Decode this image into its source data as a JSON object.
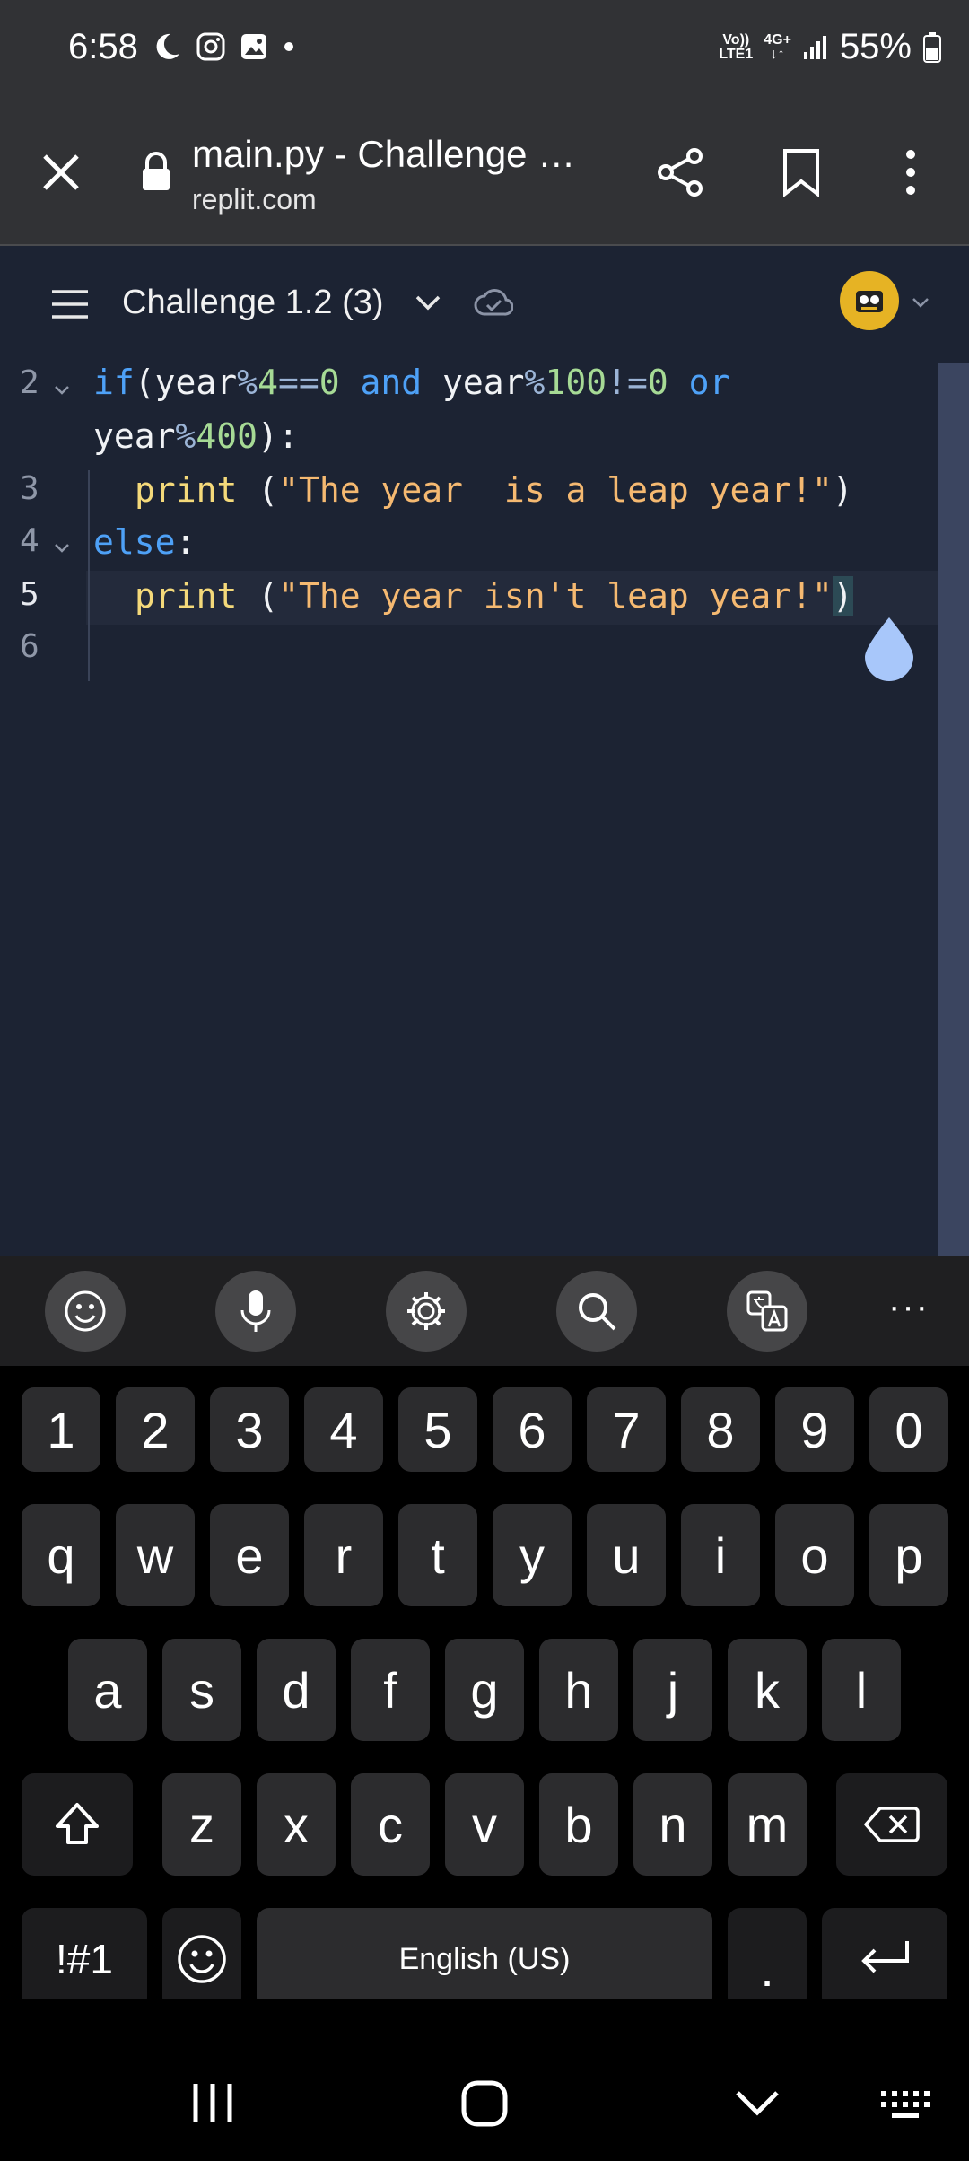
{
  "status": {
    "time": "6:58",
    "net1": "Vo))",
    "net1b": "LTE1",
    "net2": "4G+",
    "battery": "55%"
  },
  "browser": {
    "title": "main.py - Challenge …",
    "url": "replit.com"
  },
  "replit": {
    "project": "Challenge 1.2 (3)"
  },
  "code": {
    "lines": [
      {
        "num": "2"
      },
      {
        "num": "3"
      },
      {
        "num": "4"
      },
      {
        "num": "5"
      },
      {
        "num": "6"
      }
    ],
    "l2a": {
      "kw_if": "if",
      "p1": "(",
      "year1": "year",
      "mod1": "%",
      "n4": "4",
      "eq": "==",
      "n0a": "0",
      "and": "and",
      "year2": "year",
      "mod2": "%",
      "n100": "100",
      "ne": "!=",
      "n0b": "0",
      "or": "or"
    },
    "l2b": {
      "year3": "year",
      "mod3": "%",
      "n400": "400",
      "close": "):"
    },
    "l3": {
      "print": "print",
      "paren": " (",
      "str": "\"The year  is a leap year!\"",
      "close": ")"
    },
    "l4": {
      "else": "else",
      "colon": ":"
    },
    "l5": {
      "print": "print",
      "paren": " (",
      "str": "\"The year isn't leap year!\"",
      "close": ")"
    }
  },
  "keyboard": {
    "row_numbers": [
      "1",
      "2",
      "3",
      "4",
      "5",
      "6",
      "7",
      "8",
      "9",
      "0"
    ],
    "row1": [
      "q",
      "w",
      "e",
      "r",
      "t",
      "y",
      "u",
      "i",
      "o",
      "p"
    ],
    "row2": [
      "a",
      "s",
      "d",
      "f",
      "g",
      "h",
      "j",
      "k",
      "l"
    ],
    "row3": [
      "z",
      "x",
      "c",
      "v",
      "b",
      "n",
      "m"
    ],
    "symbols": "!#1",
    "space": "English (US)",
    "period": ".",
    "more": "···"
  }
}
